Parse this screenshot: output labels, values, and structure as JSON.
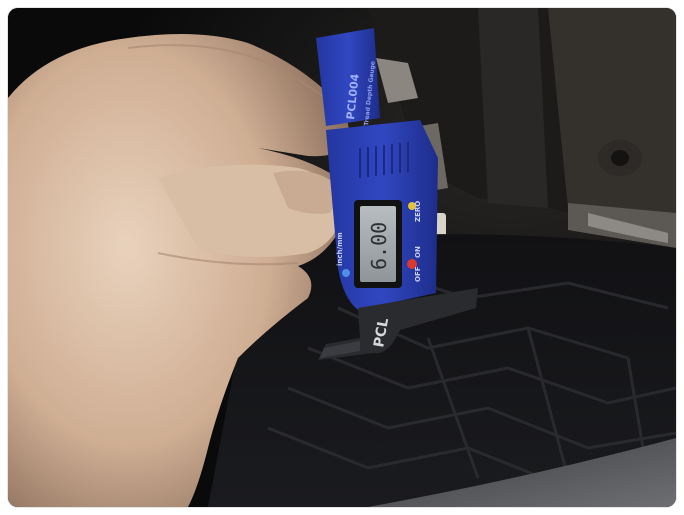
{
  "photo": {
    "subject": "hand holding digital tyre tread depth gauge",
    "gauge": {
      "brand_label": "PCL",
      "model_label": "PCL004",
      "product_label": "Tread Depth Gauge",
      "unit_button_label": "inch/mm",
      "zero_button_label": "ZERO",
      "off_label": "OFF",
      "on_label": "ON",
      "display_reading": "6.00",
      "body_color": "#2c3fb0",
      "accent_red": "#d93a2f",
      "accent_yellow": "#e2c23a"
    }
  }
}
